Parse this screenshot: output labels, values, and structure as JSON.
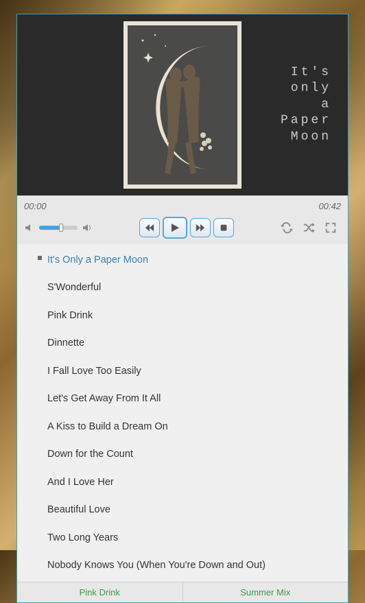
{
  "artwork": {
    "caption": "It's\n only\n    a\nPaper\n Moon"
  },
  "time": {
    "elapsed": "00:00",
    "total": "00:42"
  },
  "volume": {
    "percent": 55
  },
  "playlist": {
    "current_index": 0,
    "tracks": [
      "It's Only a Paper Moon",
      "S'Wonderful",
      "Pink Drink",
      "Dinnette",
      "I Fall Love Too Easily",
      "Let's Get Away From It All",
      "A Kiss to Build a Dream On",
      "Down for the Count",
      "And I Love Her",
      "Beautiful Love",
      "Two Long Years",
      "Nobody Knows You (When You're Down and Out)"
    ]
  },
  "footer": {
    "tabs": [
      "Pink Drink",
      "Summer Mix"
    ]
  }
}
